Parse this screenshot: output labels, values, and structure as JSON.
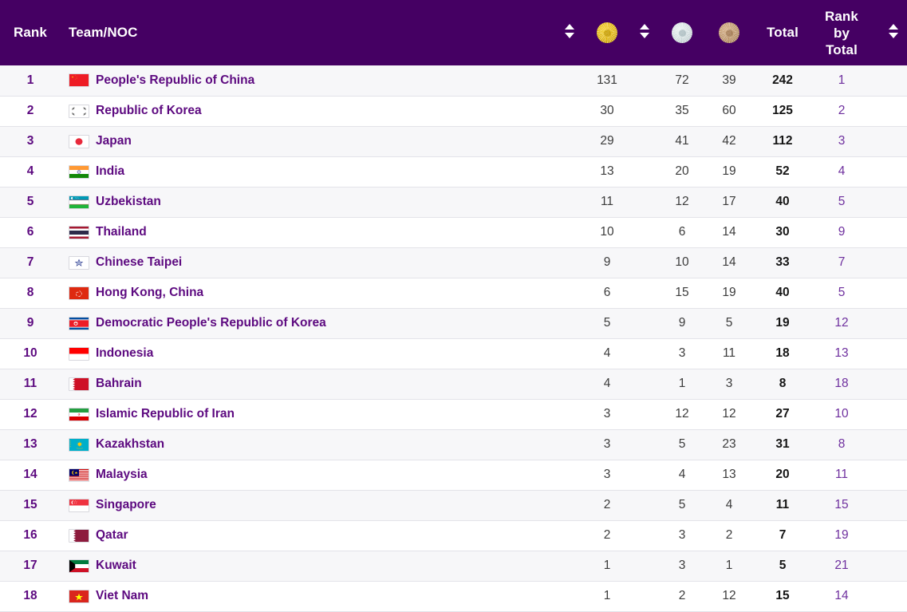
{
  "header": {
    "rank": "Rank",
    "team": "Team/NOC",
    "gold_icon": "gold-medal-icon",
    "silver_icon": "silver-medal-icon",
    "bronze_icon": "bronze-medal-icon",
    "total": "Total",
    "rank_by_total_line1": "Rank",
    "rank_by_total_line2": "by",
    "rank_by_total_line3": "Total",
    "sort_icon": "sort-arrows-icon",
    "bg_color": "#450063",
    "text_color": "#ffffff"
  },
  "colors": {
    "header_purple": "#450063",
    "team_purple": "#5d0a80",
    "rank_by_total_purple": "#6e2f9e",
    "row_alt": "#f7f7f9",
    "row_base": "#ffffff",
    "row_border": "#e3e3e9",
    "gold": "#ddb106",
    "silver": "#c9d6d8",
    "bronze": "#b88f63"
  },
  "rows": [
    {
      "rank": "1",
      "team": "People's Republic of China",
      "flag": "cn",
      "gold": "131",
      "silver": "72",
      "bronze": "39",
      "total": "242",
      "rank_by_total": "1"
    },
    {
      "rank": "2",
      "team": "Republic of Korea",
      "flag": "kr",
      "gold": "30",
      "silver": "35",
      "bronze": "60",
      "total": "125",
      "rank_by_total": "2"
    },
    {
      "rank": "3",
      "team": "Japan",
      "flag": "jp",
      "gold": "29",
      "silver": "41",
      "bronze": "42",
      "total": "112",
      "rank_by_total": "3"
    },
    {
      "rank": "4",
      "team": "India",
      "flag": "in",
      "gold": "13",
      "silver": "20",
      "bronze": "19",
      "total": "52",
      "rank_by_total": "4"
    },
    {
      "rank": "5",
      "team": "Uzbekistan",
      "flag": "uz",
      "gold": "11",
      "silver": "12",
      "bronze": "17",
      "total": "40",
      "rank_by_total": "5"
    },
    {
      "rank": "6",
      "team": "Thailand",
      "flag": "th",
      "gold": "10",
      "silver": "6",
      "bronze": "14",
      "total": "30",
      "rank_by_total": "9"
    },
    {
      "rank": "7",
      "team": "Chinese Taipei",
      "flag": "tw",
      "gold": "9",
      "silver": "10",
      "bronze": "14",
      "total": "33",
      "rank_by_total": "7"
    },
    {
      "rank": "8",
      "team": "Hong Kong, China",
      "flag": "hk",
      "gold": "6",
      "silver": "15",
      "bronze": "19",
      "total": "40",
      "rank_by_total": "5"
    },
    {
      "rank": "9",
      "team": "Democratic People's Republic of Korea",
      "flag": "kp",
      "gold": "5",
      "silver": "9",
      "bronze": "5",
      "total": "19",
      "rank_by_total": "12"
    },
    {
      "rank": "10",
      "team": "Indonesia",
      "flag": "id",
      "gold": "4",
      "silver": "3",
      "bronze": "11",
      "total": "18",
      "rank_by_total": "13"
    },
    {
      "rank": "11",
      "team": "Bahrain",
      "flag": "bh",
      "gold": "4",
      "silver": "1",
      "bronze": "3",
      "total": "8",
      "rank_by_total": "18"
    },
    {
      "rank": "12",
      "team": "Islamic Republic of Iran",
      "flag": "ir",
      "gold": "3",
      "silver": "12",
      "bronze": "12",
      "total": "27",
      "rank_by_total": "10"
    },
    {
      "rank": "13",
      "team": "Kazakhstan",
      "flag": "kz",
      "gold": "3",
      "silver": "5",
      "bronze": "23",
      "total": "31",
      "rank_by_total": "8"
    },
    {
      "rank": "14",
      "team": "Malaysia",
      "flag": "my",
      "gold": "3",
      "silver": "4",
      "bronze": "13",
      "total": "20",
      "rank_by_total": "11"
    },
    {
      "rank": "15",
      "team": "Singapore",
      "flag": "sg",
      "gold": "2",
      "silver": "5",
      "bronze": "4",
      "total": "11",
      "rank_by_total": "15"
    },
    {
      "rank": "16",
      "team": "Qatar",
      "flag": "qa",
      "gold": "2",
      "silver": "3",
      "bronze": "2",
      "total": "7",
      "rank_by_total": "19"
    },
    {
      "rank": "17",
      "team": "Kuwait",
      "flag": "kw",
      "gold": "1",
      "silver": "3",
      "bronze": "1",
      "total": "5",
      "rank_by_total": "21"
    },
    {
      "rank": "18",
      "team": "Viet Nam",
      "flag": "vn",
      "gold": "1",
      "silver": "2",
      "bronze": "12",
      "total": "15",
      "rank_by_total": "14"
    }
  ]
}
